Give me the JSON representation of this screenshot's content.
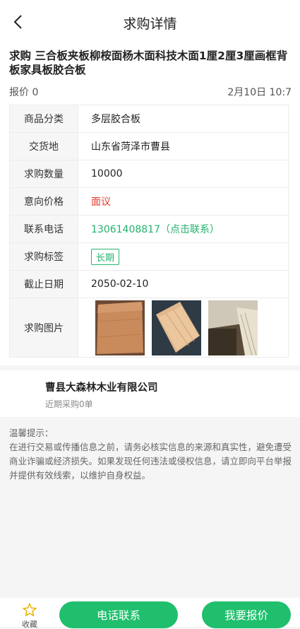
{
  "header": {
    "title": "求购详情"
  },
  "detail": {
    "title": "求购 三合板夹板柳桉面杨木面科技木面1厘2厘3厘画框背板家具板胶合板",
    "quote_count": "报价 0",
    "date": "2月10日 10:7",
    "rows": [
      {
        "label": "商品分类",
        "value": "多层胶合板"
      },
      {
        "label": "交货地",
        "value": "山东省菏泽市曹县"
      },
      {
        "label": "求购数量",
        "value": "10000"
      },
      {
        "label": "意向价格",
        "value": "面议"
      },
      {
        "label": "联系电话",
        "value": "13061408817（点击联系）"
      },
      {
        "label": "求购标签",
        "value": "长期"
      },
      {
        "label": "截止日期",
        "value": "2050-02-10"
      },
      {
        "label": "求购图片",
        "value": ""
      }
    ]
  },
  "company": {
    "name": "曹县大森林木业有限公司",
    "recent": "近期采购0单"
  },
  "notice": {
    "title": "温馨提示：",
    "body": "在进行交易或传播信息之前，请务必核实信息的来源和真实性，避免遭受商业诈骗或经济损失。如果发现任何违法或侵权信息，请立即向平台举报并提供有效线索，以维护自身权益。"
  },
  "bottom": {
    "fav_label": "收藏",
    "call_label": "电话联系",
    "quote_label": "我要报价"
  },
  "colors": {
    "accent": "#1fbf6d",
    "price_red": "#e23a2e"
  }
}
